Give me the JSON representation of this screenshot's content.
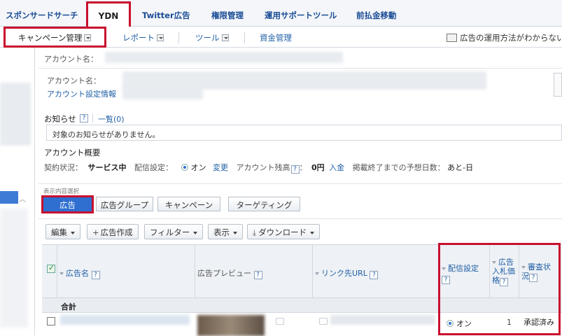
{
  "topnav": {
    "tabs": [
      {
        "label": "スポンサードサーチ"
      },
      {
        "label": "YDN"
      },
      {
        "label": "Twitter広告"
      },
      {
        "label": "権限管理"
      },
      {
        "label": "運用サポートツール"
      },
      {
        "label": "前払金移動"
      }
    ]
  },
  "subnav": {
    "campaign": "キャンペーン管理",
    "report": "レポート",
    "tool": "ツール",
    "funds": "資金管理",
    "help_link": "広告の運用方法がわからない"
  },
  "account": {
    "header_label": "アカウント名：",
    "name_label": "アカウント名：",
    "settings_link": "アカウント設定情報"
  },
  "notice": {
    "title": "お知らせ",
    "help": "?",
    "list_link": "一覧(0)",
    "message": "対象のお知らせがありません。"
  },
  "overview": {
    "title": "アカウント概要",
    "contract_label": "契約状況：",
    "contract_value": "サービス中",
    "delivery_label": "配信設定：",
    "delivery_value": "オン",
    "change_link": "変更",
    "balance_label": "アカウント残高",
    "balance_value": "0円",
    "deposit_link": "入金",
    "forecast_label": "掲載終了までの予想日数：",
    "forecast_value": "あと-日"
  },
  "view": {
    "caption": "表示内容選択",
    "buttons": [
      "広告",
      "広告グループ",
      "キャンペーン",
      "ターゲティング"
    ]
  },
  "toolbar": {
    "edit": "編集",
    "create": "広告作成",
    "filter": "フィルター",
    "display": "表示",
    "download": "ダウンロード"
  },
  "table": {
    "columns": {
      "ad_name": "広告名",
      "preview": "広告プレビュー",
      "link_url": "リンク先URL",
      "delivery": "配信設定",
      "bid_l1": "広告",
      "bid_l2": "入札価",
      "bid_l3": "格",
      "review_l1": "審査状",
      "review_l2": "況"
    },
    "total_label": "合計",
    "row": {
      "delivery": "オン",
      "bid": "1",
      "review": "承認済み"
    }
  },
  "colors": {
    "highlight": "#c8102e",
    "accent": "#2e6fd0",
    "link": "#1f5fa6"
  }
}
